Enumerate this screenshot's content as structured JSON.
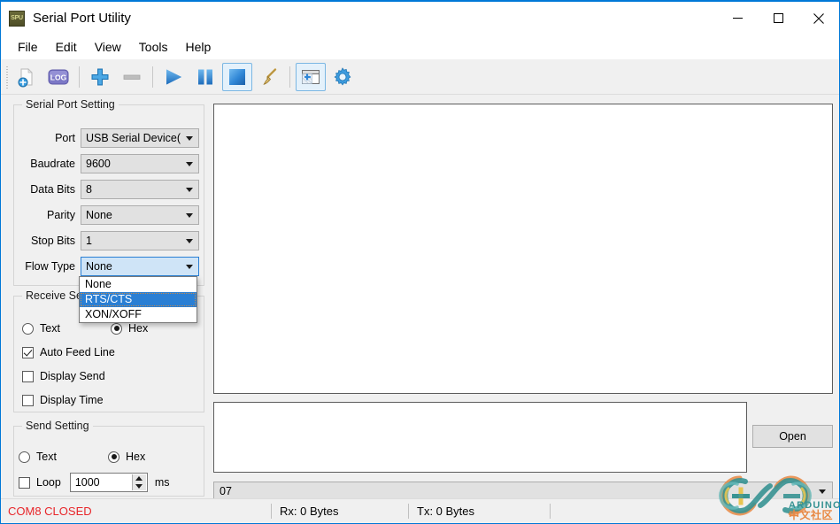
{
  "window": {
    "title": "Serial Port Utility",
    "app_icon_text": "SPU",
    "accent_color": "#0078d7",
    "controls": {
      "minimize": "minimize-icon",
      "maximize": "maximize-icon",
      "close": "close-icon"
    }
  },
  "menubar": {
    "items": [
      {
        "label": "File"
      },
      {
        "label": "Edit"
      },
      {
        "label": "View"
      },
      {
        "label": "Tools"
      },
      {
        "label": "Help"
      }
    ]
  },
  "toolbar": {
    "buttons": [
      {
        "name": "new-file-icon",
        "active": false
      },
      {
        "name": "log-icon",
        "active": false
      },
      {
        "name": "add-icon",
        "active": false
      },
      {
        "name": "remove-icon",
        "active": false
      },
      {
        "name": "play-icon",
        "active": false
      },
      {
        "name": "pause-icon",
        "active": false
      },
      {
        "name": "stop-icon",
        "active": true
      },
      {
        "name": "broom-clear-icon",
        "active": false
      },
      {
        "name": "new-window-icon",
        "active": true
      },
      {
        "name": "gear-settings-icon",
        "active": false
      }
    ]
  },
  "serial_port_setting": {
    "legend": "Serial Port Setting",
    "fields": [
      {
        "label": "Port",
        "value": "USB Serial Device(",
        "focused": false
      },
      {
        "label": "Baudrate",
        "value": "9600",
        "focused": false
      },
      {
        "label": "Data Bits",
        "value": "8",
        "focused": false
      },
      {
        "label": "Parity",
        "value": "None",
        "focused": false
      },
      {
        "label": "Stop Bits",
        "value": "1",
        "focused": false
      },
      {
        "label": "Flow Type",
        "value": "None",
        "focused": true
      }
    ],
    "flow_type_dropdown": {
      "open": true,
      "options": [
        {
          "label": "None",
          "selected": false
        },
        {
          "label": "RTS/CTS",
          "selected": true
        },
        {
          "label": "XON/XOFF",
          "selected": false
        }
      ]
    }
  },
  "receive_setting": {
    "legend": "Receive Setting",
    "format": {
      "text_label": "Text",
      "text_on": false,
      "hex_label": "Hex",
      "hex_on": true
    },
    "checkboxes": [
      {
        "label": "Auto Feed Line",
        "checked": true
      },
      {
        "label": "Display Send",
        "checked": false
      },
      {
        "label": "Display Time",
        "checked": false
      }
    ]
  },
  "send_setting": {
    "legend": "Send Setting",
    "format": {
      "text_label": "Text",
      "text_on": false,
      "hex_label": "Hex",
      "hex_on": true
    },
    "loop": {
      "label": "Loop",
      "checked": false,
      "interval": "1000",
      "unit": "ms"
    }
  },
  "main": {
    "receive_area_text": "",
    "send_area_text": "",
    "open_button_label": "Open",
    "history_combo_value": "07"
  },
  "watermark": {
    "brand": "ARDUINO",
    "subtitle": "中文社区"
  },
  "statusbar": {
    "port_status": "COM8 CLOSED",
    "port_status_color": "#e8262a",
    "rx": "Rx: 0 Bytes",
    "tx": "Tx: 0 Bytes"
  }
}
